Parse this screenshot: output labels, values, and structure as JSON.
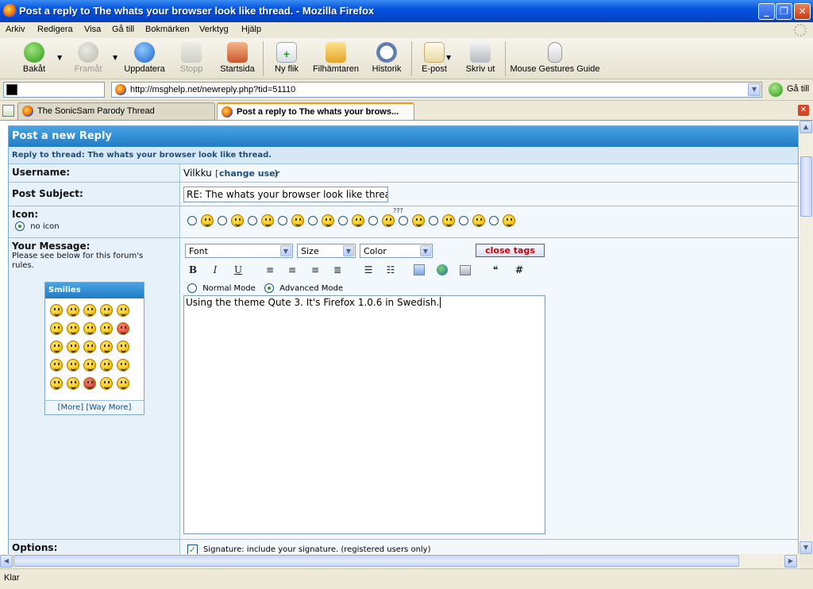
{
  "window": {
    "title": "Post a reply to The whats your browser look like thread. - Mozilla Firefox",
    "minimize": "_",
    "maximize": "❐",
    "close": "✕"
  },
  "menu": [
    "Arkiv",
    "Redigera",
    "Visa",
    "Gå till",
    "Bokmärken",
    "Verktyg",
    "Hjälp"
  ],
  "toolbar": {
    "back": "Bakåt",
    "forward": "Framåt",
    "reload": "Uppdatera",
    "stop": "Stopp",
    "home": "Startsida",
    "new_tab": "Ny flik",
    "downloads": "Filhämtaren",
    "history": "Historik",
    "email": "E-post",
    "print": "Skriv ut",
    "gestures": "Mouse Gestures Guide"
  },
  "urlbar": {
    "url": "http://msghelp.net/newreply.php?tid=51110",
    "go": "Gå till"
  },
  "tabs": [
    {
      "label": "The SonicSam Parody Thread",
      "active": false
    },
    {
      "label": "Post a reply to The whats your brows...",
      "active": true
    }
  ],
  "form": {
    "header": "Post a new Reply",
    "subheader": "Reply to thread: The whats your browser look like thread.",
    "username_label": "Username:",
    "username_value": "Vilkku",
    "change_user": "change user",
    "subject_label": "Post Subject:",
    "subject_value": "RE: The whats your browser look like thread.",
    "icon_label": "Icon:",
    "no_icon": "no icon",
    "icon_question_marks": "???",
    "message_label": "Your Message:",
    "message_note": "Please see below for this forum's rules.",
    "font_select": "Font",
    "size_select": "Size",
    "color_select": "Color",
    "close_tags": "close tags",
    "bold": "B",
    "italic": "I",
    "underline": "U",
    "hash": "#",
    "normal_mode": "Normal Mode",
    "advanced_mode": "Advanced Mode",
    "message_text": "Using the theme Qute 3. It's Firefox 1.0.6 in Swedish.",
    "smilies_title": "Smilies",
    "smilies_more": "[More]",
    "smilies_way_more": "[Way More]",
    "options_label": "Options:",
    "signature_text": "Signature: include your signature. (registered users only)"
  },
  "status": {
    "text": "Klar"
  },
  "colors": {
    "titlebar": "#0553de",
    "header": "#1f7cc6",
    "accent_red": "#cc0000"
  }
}
